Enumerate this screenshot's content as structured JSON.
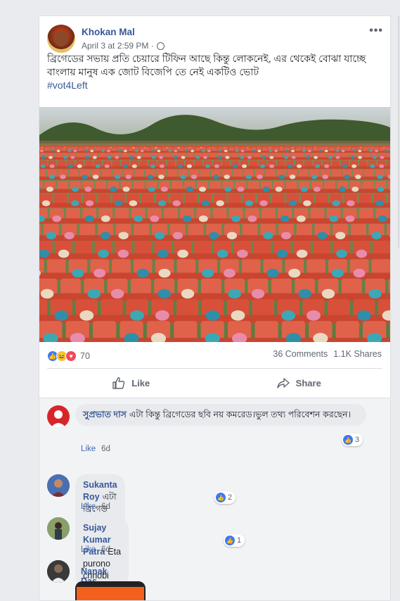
{
  "post": {
    "author": "Khokan Mal",
    "timestamp": "April 3 at 2:59 PM · ",
    "more": "•••",
    "text": "ব্রিগেডের সভায় প্রতি চেয়ারে টিফিন আছে কিন্তু লোকনেই, এর থেকেই বোঝা যাচ্ছে বাংলায় মানুষ এক জোট বিজেপি তে নেই একটিও ভোট",
    "hashtag": "#vot4Left"
  },
  "engagement": {
    "reactions_count": "70",
    "comments": "36 Comments",
    "shares": "1.1K Shares"
  },
  "actions": {
    "like_label": "Like",
    "share_label": "Share"
  },
  "comments": [
    {
      "name": "সুপ্রভাত দাস",
      "text": "এটা কিন্তু ব্রিগেডের ছবি নয় কমরেড।ভুল তথ্য পরিবেশন করছেন।",
      "like": "Like",
      "time": "6d",
      "reactions": "3"
    },
    {
      "name": "Sukanta Roy",
      "text": "এটা ব্রিগেড ময়দান নয়।",
      "like": "Like",
      "time": "6d",
      "reactions": "2"
    },
    {
      "name": "Sujay Kumar Patra",
      "text": "Eta purono chhobi",
      "like": "Like",
      "time": "6d",
      "reactions": "1"
    },
    {
      "name": "Nanak Das",
      "text": "",
      "like": "",
      "time": "",
      "reactions": ""
    }
  ],
  "colors": {
    "link": "#365899",
    "like_blue": "#3b79f6",
    "chair_red": "#e0563f",
    "grass": "#6b8a4e"
  },
  "icons": {
    "globe": "globe-icon",
    "like": "thumbs-up-icon",
    "share": "share-arrow-icon",
    "more": "more-options-icon"
  }
}
